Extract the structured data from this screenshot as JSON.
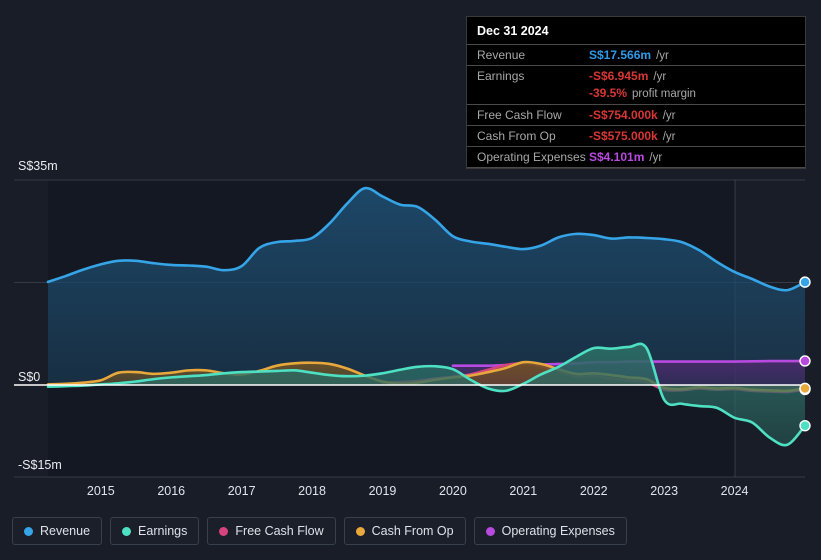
{
  "chart_data": {
    "type": "area",
    "title": "",
    "xlabel": "",
    "ylabel": "",
    "currency": "S$",
    "grid": true,
    "legend_position": "bottom-left",
    "ylim": [
      -15,
      35
    ],
    "y_ticks": [
      {
        "label": "S$35m",
        "value": 35
      },
      {
        "label": "S$0",
        "value": 0
      },
      {
        "label": "-S$15m",
        "value": -15
      }
    ],
    "x_ticks": [
      "2015",
      "2016",
      "2017",
      "2018",
      "2019",
      "2020",
      "2021",
      "2022",
      "2023",
      "2024"
    ],
    "x": [
      2014.25,
      2014.5,
      2014.75,
      2015.0,
      2015.25,
      2015.5,
      2015.75,
      2016.0,
      2016.25,
      2016.5,
      2016.75,
      2017.0,
      2017.25,
      2017.5,
      2017.75,
      2018.0,
      2018.25,
      2018.5,
      2018.75,
      2019.0,
      2019.25,
      2019.5,
      2019.75,
      2020.0,
      2020.25,
      2020.5,
      2020.75,
      2021.0,
      2021.25,
      2021.5,
      2021.75,
      2022.0,
      2022.25,
      2022.5,
      2022.75,
      2023.0,
      2023.25,
      2023.5,
      2023.75,
      2024.0,
      2024.25,
      2024.5,
      2024.75,
      2025.0
    ],
    "series": [
      {
        "name": "Revenue",
        "color": "#35a5e8",
        "fill": "#1d4a6b",
        "end_value_label": "S$17.566m",
        "values": [
          17.6,
          18.6,
          19.7,
          20.6,
          21.2,
          21.2,
          20.8,
          20.5,
          20.4,
          20.2,
          19.6,
          20.3,
          23.4,
          24.4,
          24.6,
          25.1,
          27.6,
          31.0,
          33.6,
          32.2,
          30.8,
          30.4,
          28.2,
          25.4,
          24.5,
          24.1,
          23.6,
          23.2,
          23.8,
          25.2,
          25.8,
          25.6,
          25.0,
          25.2,
          25.1,
          24.9,
          24.4,
          23.0,
          21.0,
          19.3,
          18.1,
          16.8,
          16.2,
          17.566
        ]
      },
      {
        "name": "Earnings",
        "color": "#4ee0c2",
        "fill": "#2c6b64",
        "end_value_label": "-S$6.945m",
        "values": [
          -0.3,
          -0.2,
          -0.1,
          0.1,
          0.3,
          0.6,
          1.0,
          1.3,
          1.5,
          1.7,
          2.0,
          2.2,
          2.3,
          2.4,
          2.5,
          2.1,
          1.7,
          1.5,
          1.6,
          2.0,
          2.6,
          3.1,
          3.2,
          2.7,
          0.9,
          -0.6,
          -1.0,
          0.2,
          1.8,
          3.1,
          4.8,
          6.3,
          6.2,
          6.5,
          6.3,
          -2.5,
          -3.2,
          -3.6,
          -3.9,
          -5.6,
          -6.4,
          -9.0,
          -10.2,
          -6.945
        ]
      },
      {
        "name": "Free Cash Flow",
        "color": "#d6447f",
        "fill": "#6b2844",
        "end_value_label": "-S$754.000k",
        "values": [
          null,
          null,
          null,
          null,
          null,
          null,
          null,
          null,
          null,
          null,
          null,
          null,
          null,
          null,
          null,
          null,
          null,
          null,
          null,
          0.4,
          0.5,
          0.7,
          1.1,
          1.4,
          1.8,
          2.6,
          3.4,
          3.7,
          3.2,
          2.3,
          1.4,
          1.5,
          1.1,
          0.8,
          0.5,
          -0.8,
          -0.9,
          -0.6,
          -0.8,
          -0.7,
          -1.0,
          -1.1,
          -1.2,
          -0.754
        ]
      },
      {
        "name": "Cash From Op",
        "color": "#e8a83c",
        "fill": "#6b5226",
        "end_value_label": "-S$575.000k",
        "values": [
          0.1,
          0.2,
          0.4,
          0.8,
          2.1,
          2.2,
          1.9,
          2.1,
          2.5,
          2.5,
          2.0,
          1.8,
          2.4,
          3.3,
          3.7,
          3.8,
          3.6,
          2.8,
          1.6,
          0.6,
          0.2,
          0.4,
          0.9,
          1.3,
          1.6,
          2.2,
          2.9,
          3.9,
          3.6,
          2.7,
          1.9,
          2.0,
          1.7,
          1.3,
          1.0,
          -0.5,
          -0.7,
          -0.4,
          -0.6,
          -0.5,
          -0.8,
          -0.9,
          -1.0,
          -0.575
        ]
      },
      {
        "name": "Operating Expenses",
        "color": "#b84ae0",
        "fill": "#4a2a6b",
        "end_value_label": "S$4.101m",
        "values": [
          null,
          null,
          null,
          null,
          null,
          null,
          null,
          null,
          null,
          null,
          null,
          null,
          null,
          null,
          null,
          null,
          null,
          null,
          null,
          null,
          null,
          null,
          null,
          3.3,
          3.3,
          3.3,
          3.4,
          3.4,
          3.5,
          3.6,
          3.7,
          3.9,
          3.9,
          4.0,
          4.0,
          4.0,
          4.0,
          4.0,
          4.0,
          4.0,
          4.05,
          4.08,
          4.09,
          4.101
        ]
      }
    ]
  },
  "tooltip": {
    "date": "Dec 31 2024",
    "rows": [
      {
        "key": "Revenue",
        "value": "S$17.566m",
        "unit": "/yr",
        "color": "#2f9ae8"
      },
      {
        "key": "Earnings",
        "value": "-S$6.945m",
        "unit": "/yr",
        "color": "#d93636"
      },
      {
        "key": "",
        "value": "-39.5%",
        "unit": "profit margin",
        "color": "#d93636",
        "sub": true
      },
      {
        "key": "Free Cash Flow",
        "value": "-S$754.000k",
        "unit": "/yr",
        "color": "#d93636"
      },
      {
        "key": "Cash From Op",
        "value": "-S$575.000k",
        "unit": "/yr",
        "color": "#d93636"
      },
      {
        "key": "Operating Expenses",
        "value": "S$4.101m",
        "unit": "/yr",
        "color": "#b84ae0"
      }
    ]
  },
  "legend": {
    "items": [
      {
        "label": "Revenue",
        "color": "#35a5e8"
      },
      {
        "label": "Earnings",
        "color": "#4ee0c2"
      },
      {
        "label": "Free Cash Flow",
        "color": "#d6447f"
      },
      {
        "label": "Cash From Op",
        "color": "#e8a83c"
      },
      {
        "label": "Operating Expenses",
        "color": "#b84ae0"
      }
    ]
  }
}
